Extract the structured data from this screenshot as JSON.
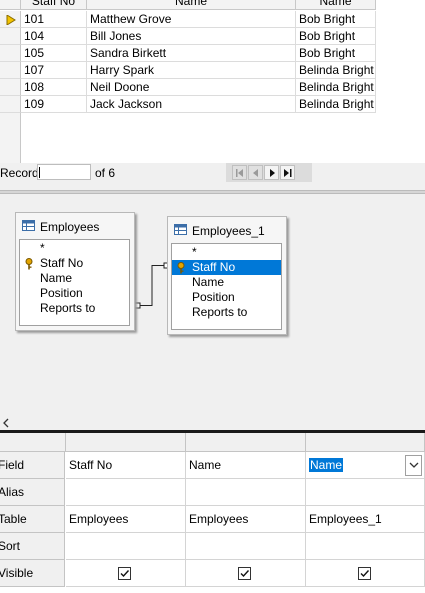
{
  "result_grid": {
    "columns": [
      "Staff No",
      "Name",
      "Name"
    ],
    "rows": [
      [
        "101",
        "Matthew Grove",
        "Bob Bright"
      ],
      [
        "104",
        "Bill Jones",
        "Bob Bright"
      ],
      [
        "105",
        "Sandra Birkett",
        "Bob Bright"
      ],
      [
        "107",
        "Harry Spark",
        "Belinda Bright"
      ],
      [
        "108",
        "Neil Doone",
        "Belinda Bright"
      ],
      [
        "109",
        "Jack Jackson",
        "Belinda Bright"
      ]
    ],
    "current_row": 0
  },
  "navigation": {
    "record_label": "Record",
    "record_value": "",
    "of_label": "of 6"
  },
  "tables": [
    {
      "title": "Employees",
      "fields": [
        "*",
        "Staff No",
        "Name",
        "Position",
        "Reports to"
      ],
      "key_field": 1,
      "selected_field": -1
    },
    {
      "title": "Employees_1",
      "fields": [
        "*",
        "Staff No",
        "Name",
        "Position",
        "Reports to"
      ],
      "key_field": 1,
      "selected_field": 1
    }
  ],
  "criteria": {
    "row_labels": [
      "Field",
      "Alias",
      "Table",
      "Sort",
      "Visible"
    ],
    "columns": [
      {
        "field": "Staff No",
        "alias": "",
        "table": "Employees",
        "sort": "",
        "visible": true
      },
      {
        "field": "Name",
        "alias": "",
        "table": "Employees",
        "sort": "",
        "visible": true
      },
      {
        "field": "Name",
        "alias": "",
        "table": "Employees_1",
        "sort": "",
        "visible": true,
        "editing": true
      }
    ]
  },
  "icons": {
    "row_pointer": "current-row-arrow-icon",
    "table_header": "table-icon",
    "primary_key": "key-icon",
    "nav_first": "first-record-icon",
    "nav_prev": "previous-record-icon",
    "nav_next": "next-record-icon",
    "nav_last": "last-record-icon",
    "scroll_left": "scroll-left-icon",
    "dropdown": "chevron-down-icon",
    "checkbox": "check-icon"
  },
  "colors": {
    "selection": "#0078d7",
    "row_pointer": "#e8b400"
  }
}
